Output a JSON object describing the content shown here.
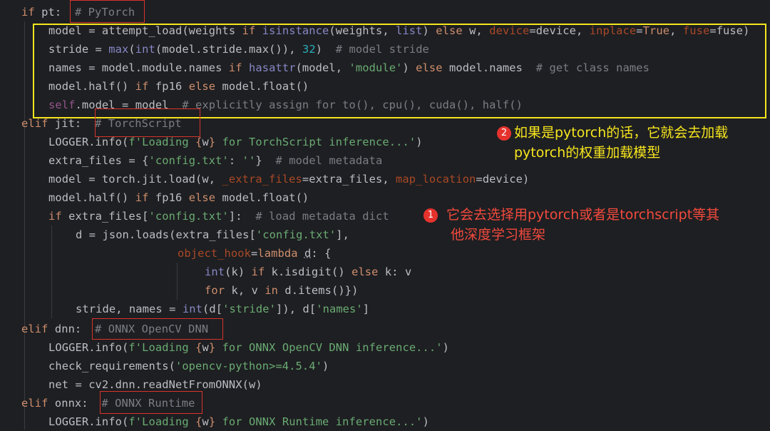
{
  "code": {
    "lines": [
      [
        "if pt:  ",
        "# PyTorch"
      ],
      [
        "model = attempt_load(weights if isinstance(weights, list) else w, device=device, inplace=True, fuse=fuse)"
      ],
      [
        "stride = max(int(model.stride.max()), 32)  # model stride"
      ],
      [
        "names = model.module.names if hasattr(model, 'module') else model.names  # get class names"
      ],
      [
        "model.half() if fp16 else model.float()"
      ],
      [
        "self.model = model  # explicitly assign for to(), cpu(), cuda(), half()"
      ],
      [
        "elif jit:  # TorchScript"
      ],
      [
        "LOGGER.info(f'Loading {w} for TorchScript inference...')"
      ],
      [
        "extra_files = {'config.txt': ''}  # model metadata"
      ],
      [
        "model = torch.jit.load(w, _extra_files=extra_files, map_location=device)"
      ],
      [
        "model.half() if fp16 else model.float()"
      ],
      [
        "if extra_files['config.txt']:  # load metadata dict"
      ],
      [
        "d = json.loads(extra_files['config.txt'],"
      ],
      [
        "object_hook=lambda d: {"
      ],
      [
        "int(k) if k.isdigit() else k: v"
      ],
      [
        "for k, v in d.items()})"
      ],
      [
        "stride, names = int(d['stride']), d['names']"
      ],
      [
        "elif dnn:  # ONNX OpenCV DNN"
      ],
      [
        "LOGGER.info(f'Loading {w} for ONNX OpenCV DNN inference...')"
      ],
      [
        "check_requirements('opencv-python>=4.5.4')"
      ],
      [
        "net = cv2.dnn.readNetFromONNX(w)"
      ],
      [
        "elif onnx:  # ONNX Runtime"
      ],
      [
        "LOGGER.info(f'Loading {w} for ONNX Runtime inference...')"
      ]
    ]
  },
  "annotations": {
    "note2": {
      "badge": "2",
      "line1": "如果是pytorch的话，它就会去加载",
      "line2": "pytorch的权重加载模型",
      "color": "#f6e51d"
    },
    "note1": {
      "badge": "1",
      "line1": "它会去选择用pytorch或者是torchscript等其",
      "line2": "他深度学习框架",
      "color": "#f24a3d"
    }
  },
  "colors": {
    "background": "#1e1f22",
    "keyword": "#cf8e6d",
    "string": "#6aab73",
    "comment": "#7a7e85",
    "function": "#56a8f5",
    "number": "#2aacb8",
    "highlight_box": "#f6e51d",
    "marker_box": "#d7332c"
  }
}
